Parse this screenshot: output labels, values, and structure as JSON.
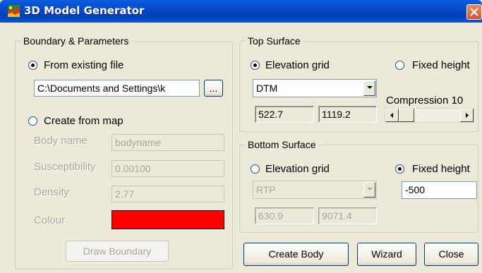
{
  "window": {
    "title": "3D Model Generator"
  },
  "boundary": {
    "legend": "Boundary & Parameters",
    "from_file_label": "From existing file",
    "file_path": "C:\\Documents and Settings\\k",
    "browse_label": "...",
    "create_map_label": "Create from map",
    "body_name_label": "Body name",
    "body_name_value": "bodyname",
    "susceptibility_label": "Susceptibility",
    "susceptibility_value": "0.00100",
    "density_label": "Density",
    "density_value": "2.77",
    "colour_label": "Colour",
    "colour_value": "#ff0000",
    "draw_boundary_label": "Draw Boundary",
    "selected_mode": "from_existing_file"
  },
  "top_surface": {
    "legend": "Top Surface",
    "elevation_label": "Elevation grid",
    "fixed_label": "Fixed height",
    "grid_selected": "DTM",
    "min_value": "522.7",
    "max_value": "1119.2",
    "compression_label": "Compression 10",
    "selected_mode": "elevation_grid"
  },
  "bottom_surface": {
    "legend": "Bottom Surface",
    "elevation_label": "Elevation grid",
    "fixed_label": "Fixed height",
    "grid_selected": "RTP",
    "fixed_value": "-500",
    "min_value": "630.9",
    "max_value": "9071.4",
    "selected_mode": "fixed_height"
  },
  "actions": {
    "create_body_label": "Create Body",
    "wizard_label": "Wizard",
    "close_label": "Close"
  },
  "icons": {
    "app": "map-icon",
    "close": "close-icon",
    "combo": "chevron-down-icon",
    "scroll_left": "arrow-left-icon",
    "scroll_right": "arrow-right-icon"
  }
}
